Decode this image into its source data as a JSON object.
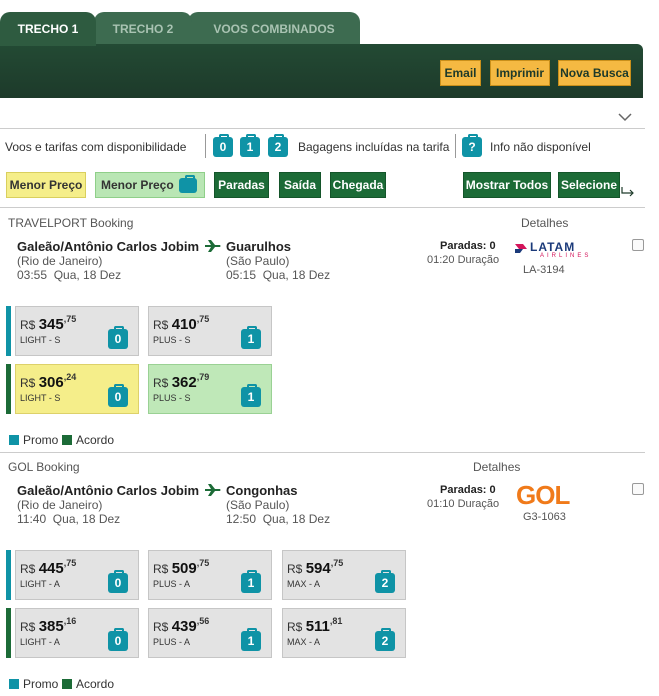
{
  "tabs": [
    {
      "label": "TRECHO 1",
      "active": true
    },
    {
      "label": "TRECHO 2",
      "active": false
    },
    {
      "label": "VOOS COMBINADOS",
      "active": false
    }
  ],
  "actions": {
    "email": "Email",
    "print": "Imprimir",
    "new_search": "Nova Busca"
  },
  "legend": {
    "available": "Voos e tarifas com disponibilidade",
    "bags": [
      "0",
      "1",
      "2"
    ],
    "bags_label": "Bagagens incluídas na tarifa",
    "info_icon": "?",
    "info_label": "Info não disponível"
  },
  "filters": {
    "lowest_price": "Menor Preço",
    "lowest_price_bag": "Menor Preço",
    "stops": "Paradas",
    "departure": "Saída",
    "arrival": "Chegada",
    "show_all": "Mostrar Todos",
    "select": "Selecione"
  },
  "flights": [
    {
      "provider": "TRAVELPORT Booking",
      "details_label": "Detalhes",
      "origin": "Galeão/Antônio Carlos Jobim",
      "origin_city": "(Rio de Janeiro)",
      "departure": "03:55  Qua, 18 Dez",
      "destination": "Guarulhos",
      "destination_city": "(São Paulo)",
      "arrival": "05:15  Qua, 18 Dez",
      "stops": "Paradas: 0",
      "duration": "01:20 Duração",
      "airline_logo": "LATAM",
      "airline_sub": "AIRLINES",
      "flight_number": "LA-3194",
      "fare_rows": [
        {
          "type": "promo",
          "fares": [
            {
              "currency": "R$",
              "int": "345",
              "cents": "75",
              "cls": "LIGHT - S",
              "bags": "0",
              "style": "grey"
            },
            {
              "currency": "R$",
              "int": "410",
              "cents": "75",
              "cls": "PLUS - S",
              "bags": "1",
              "style": "grey"
            }
          ]
        },
        {
          "type": "acordo",
          "fares": [
            {
              "currency": "R$",
              "int": "306",
              "cents": "24",
              "cls": "LIGHT - S",
              "bags": "0",
              "style": "yellow"
            },
            {
              "currency": "R$",
              "int": "362",
              "cents": "79",
              "cls": "PLUS - S",
              "bags": "1",
              "style": "green"
            }
          ]
        }
      ],
      "legend_promo": "Promo",
      "legend_acordo": "Acordo"
    },
    {
      "provider": "GOL Booking",
      "details_label": "Detalhes",
      "origin": "Galeão/Antônio Carlos Jobim",
      "origin_city": "(Rio de Janeiro)",
      "departure": "11:40  Qua, 18 Dez",
      "destination": "Congonhas",
      "destination_city": "(São Paulo)",
      "arrival": "12:50  Qua, 18 Dez",
      "stops": "Paradas: 0",
      "duration": "01:10 Duração",
      "airline_logo": "GOL",
      "flight_number": "G3-1063",
      "fare_rows": [
        {
          "type": "promo",
          "fares": [
            {
              "currency": "R$",
              "int": "445",
              "cents": "75",
              "cls": "LIGHT - A",
              "bags": "0",
              "style": "grey"
            },
            {
              "currency": "R$",
              "int": "509",
              "cents": "75",
              "cls": "PLUS - A",
              "bags": "1",
              "style": "grey"
            },
            {
              "currency": "R$",
              "int": "594",
              "cents": "75",
              "cls": "MAX - A",
              "bags": "2",
              "style": "grey"
            }
          ]
        },
        {
          "type": "acordo",
          "fares": [
            {
              "currency": "R$",
              "int": "385",
              "cents": "16",
              "cls": "LIGHT - A",
              "bags": "0",
              "style": "grey"
            },
            {
              "currency": "R$",
              "int": "439",
              "cents": "56",
              "cls": "PLUS - A",
              "bags": "1",
              "style": "grey"
            },
            {
              "currency": "R$",
              "int": "511",
              "cents": "81",
              "cls": "MAX - A",
              "bags": "2",
              "style": "grey"
            }
          ]
        }
      ],
      "legend_promo": "Promo",
      "legend_acordo": "Acordo"
    }
  ],
  "colors": {
    "header": "#1d3a2a",
    "accent_orange": "#f5b942",
    "teal": "#0f93a6",
    "dark_green": "#1c6b37",
    "yellow": "#f5ee8a",
    "light_green": "#bfe8b8"
  }
}
